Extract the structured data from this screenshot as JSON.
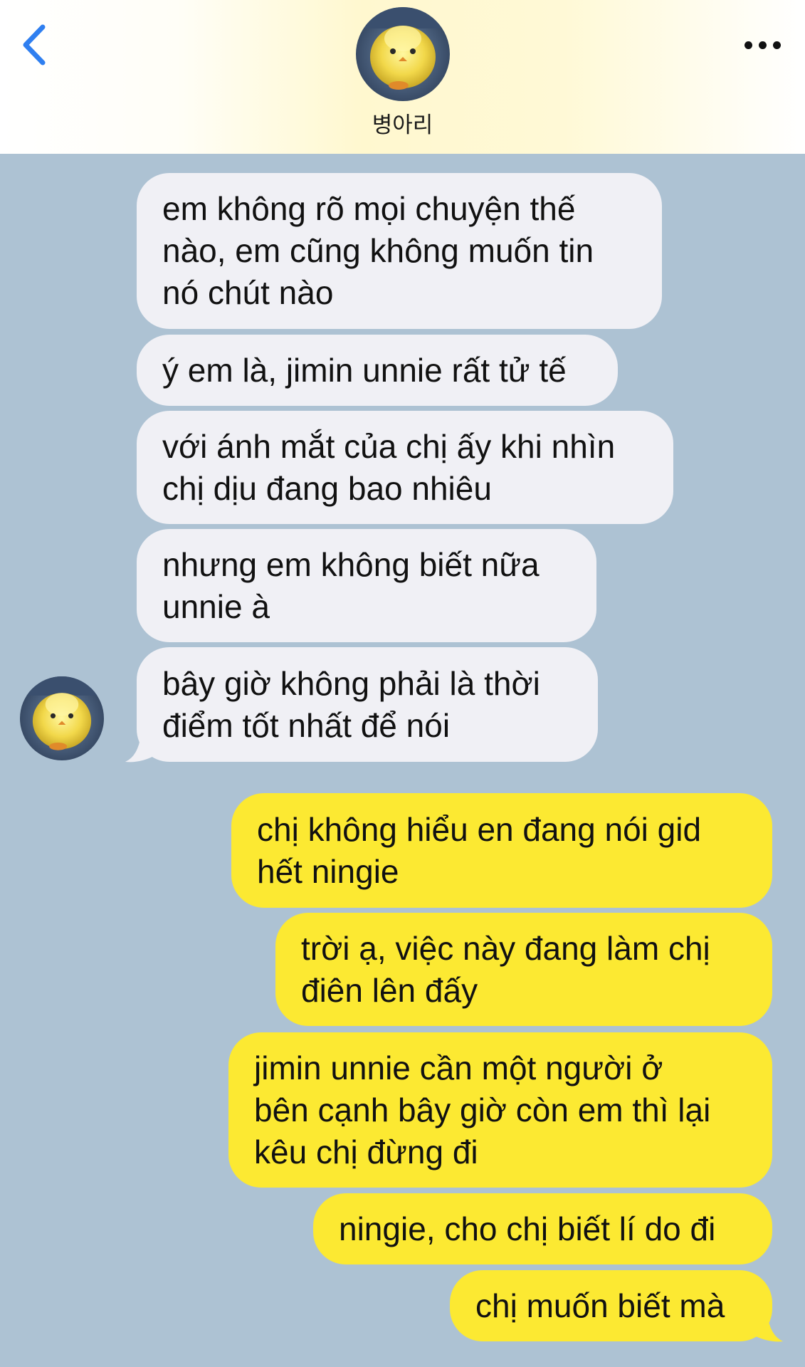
{
  "header": {
    "contact_name": "병아리"
  },
  "icons": {
    "back": "chevron-left-icon",
    "more": "more-horizontal-icon",
    "avatar": "yellow-chick-photo"
  },
  "colors": {
    "accent": "#2f7ff0",
    "chat_background": "#adc2d3",
    "incoming_bubble": "#f0f0f5",
    "outgoing_bubble": "#fce932"
  },
  "messages": {
    "incoming": [
      {
        "lines": [
          "em không rõ mọi chuyện thế",
          "nào, em cũng không muốn tin",
          "nó chút nào"
        ]
      },
      {
        "lines": [
          "ý em là, jimin unnie rất tử tế"
        ]
      },
      {
        "lines": [
          "với ánh mắt của chị ấy khi nhìn",
          "chị dịu đang bao nhiêu"
        ]
      },
      {
        "lines": [
          "nhưng em không biết nữa",
          "unnie à"
        ]
      },
      {
        "lines": [
          "bây giờ không phải là thời",
          "điểm tốt nhất để nói"
        ]
      }
    ],
    "outgoing": [
      {
        "lines": [
          "chị không hiểu en đang nói gid",
          "hết ningie"
        ]
      },
      {
        "lines": [
          "trời ạ, việc này đang làm chị",
          "điên lên đấy"
        ]
      },
      {
        "lines": [
          "jimin unnie cần một người ở",
          "bên cạnh bây giờ còn em thì lại",
          "kêu chị đừng đi"
        ]
      },
      {
        "lines": [
          "ningie, cho chị biết lí do đi"
        ]
      },
      {
        "lines": [
          "chị muốn biết mà"
        ]
      }
    ]
  }
}
